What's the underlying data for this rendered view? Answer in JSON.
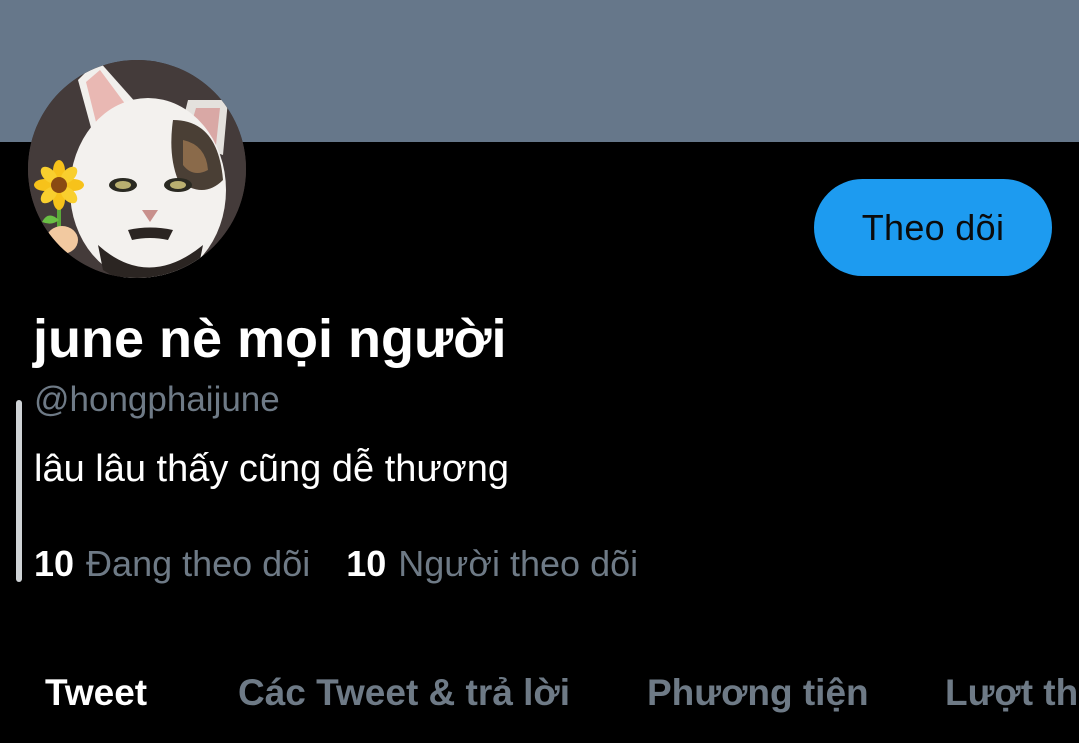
{
  "profile": {
    "display_name": "june nè mọi người",
    "handle": "@hongphaijune",
    "bio": "lâu lâu thấy cũng dễ thương",
    "avatar_icon": "cat-avatar-with-flower"
  },
  "actions": {
    "follow_label": "Theo dõi"
  },
  "stats": {
    "following_count": "10",
    "following_label": "Đang theo dõi",
    "followers_count": "10",
    "followers_label": "Người theo dõi"
  },
  "tabs": [
    {
      "label": "Tweet",
      "active": true
    },
    {
      "label": "Các Tweet & trả lời",
      "active": false
    },
    {
      "label": "Phương tiện",
      "active": false
    },
    {
      "label": "Lượt thí",
      "active": false
    }
  ],
  "colors": {
    "banner": "#66778a",
    "background": "#000000",
    "accent": "#1d9bf0",
    "muted_text": "#6e7a86"
  }
}
